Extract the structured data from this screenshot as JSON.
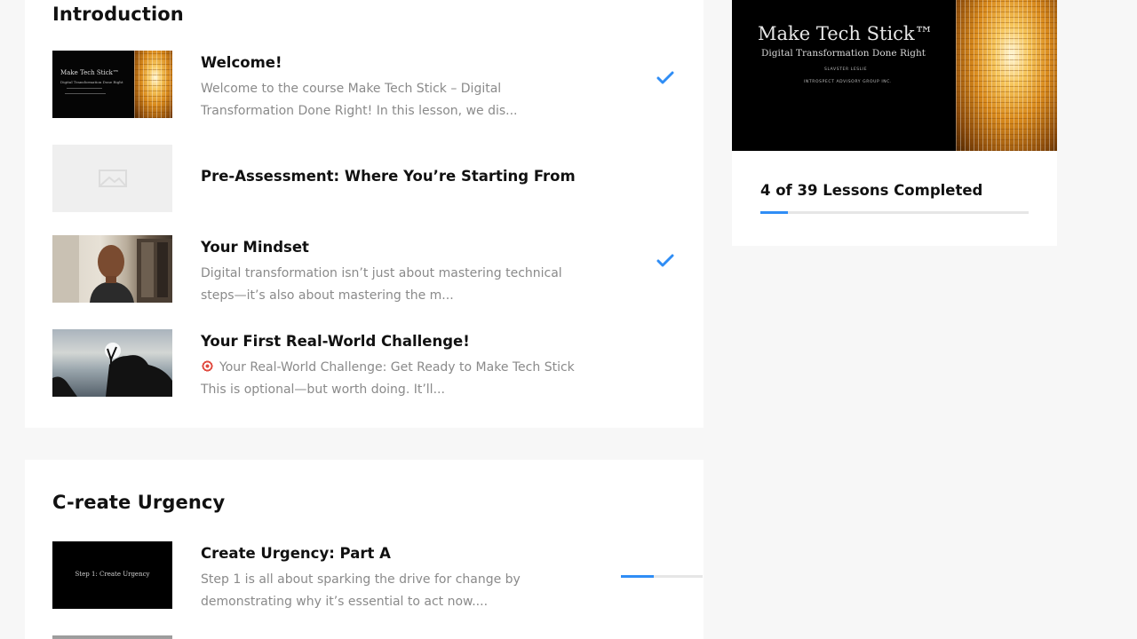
{
  "sections": [
    {
      "title": "Introduction",
      "lessons": [
        {
          "title": "Welcome!",
          "description_line1": "Welcome to the course Make Tech Stick – Digital",
          "description_line2": "Transformation Done Right! In this lesson, we dis...",
          "thumbnail_title": "Make Tech Stick™",
          "thumbnail_subtitle": "Digital Transformation Done Right",
          "completed": true
        },
        {
          "title": "Pre-Assessment: Where You’re Starting From",
          "thumbnail_icon": "image-placeholder-icon"
        },
        {
          "title": "Your Mindset",
          "description_line1": "Digital transformation isn’t just about mastering technical",
          "description_line2": "steps—it’s also about mastering the m...",
          "completed": true
        },
        {
          "title": "Your First Real-World Challenge!",
          "description_line1": "Your Real-World Challenge: Get Ready to Make Tech Stick",
          "description_line2": "This is optional—but worth doing. It’ll...",
          "description_icon": "target-emoji-icon"
        }
      ]
    },
    {
      "title": "C-reate Urgency",
      "lessons": [
        {
          "title": "Create Urgency: Part A",
          "description_line1": "Step 1 is all about sparking the drive for change by",
          "description_line2": "demonstrating why it’s essential to act now....",
          "thumbnail_text": "Step 1: Create Urgency",
          "progress": 0.4
        }
      ]
    }
  ],
  "sidebar": {
    "course_title": "Make Tech Stick™",
    "course_subtitle": "Digital Transformation Done Right",
    "author": "SLAVSTER LESLIE",
    "organization": "INTROSPECT ADVISORY GROUP INC.",
    "progress_label": "4 of 39 Lessons Completed",
    "lessons_completed": 4,
    "lessons_total": 39
  },
  "colors": {
    "accent": "#2f8df5",
    "background": "#f7f7f7",
    "card": "#ffffff",
    "muted_text": "#8a8a8a"
  }
}
